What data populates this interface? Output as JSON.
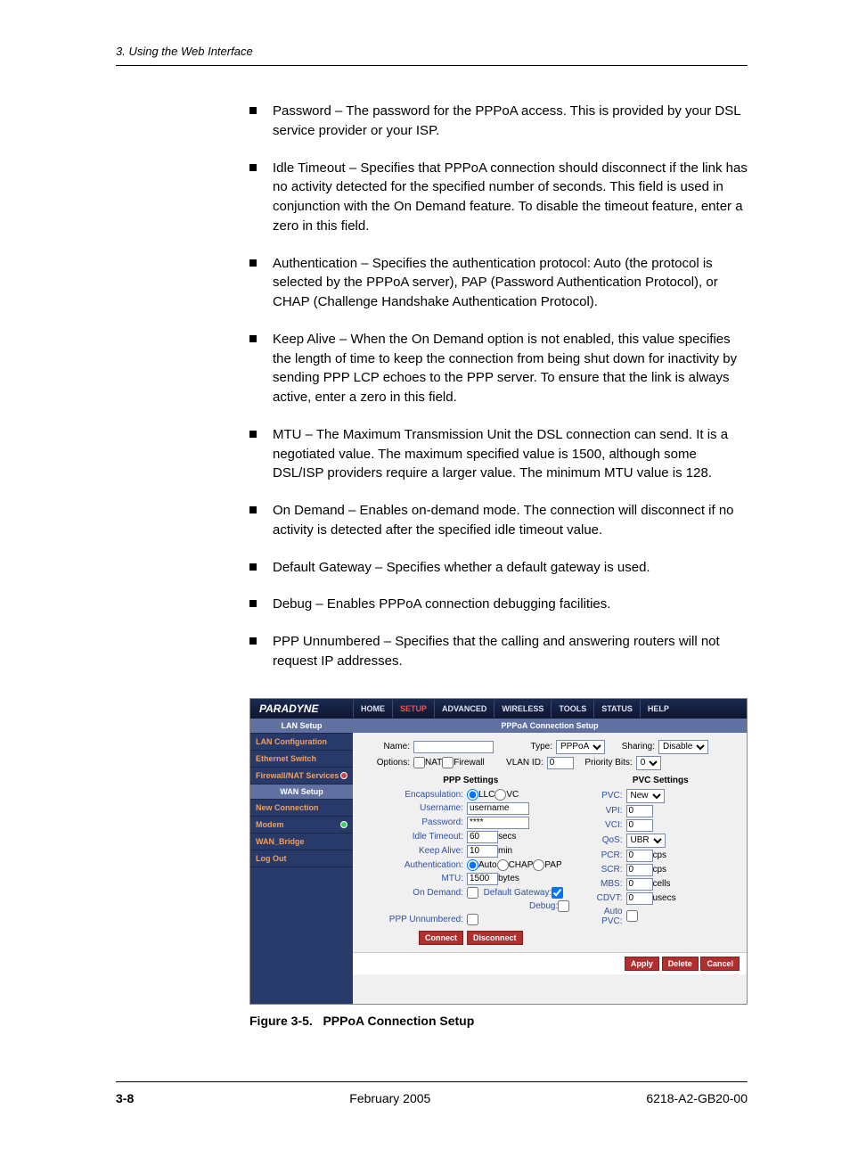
{
  "header": {
    "chapter": "3. Using the Web Interface"
  },
  "bullets": [
    "Password – The password for the PPPoA access. This is provided by your DSL service provider or your ISP.",
    "Idle Timeout – Specifies that PPPoA connection should disconnect if the link has no activity detected for the specified number of seconds. This field is used in conjunction with the On Demand feature. To disable the timeout feature, enter a zero in this field.",
    "Authentication – Specifies the authentication protocol: Auto (the protocol is selected by the PPPoA server), PAP (Password Authentication Protocol), or CHAP (Challenge Handshake Authentication Protocol).",
    "Keep Alive – When the On Demand option is not enabled, this value specifies the length of time to keep the connection from being shut down for inactivity by sending PPP LCP echoes to the PPP server. To ensure that the link is always active, enter a zero in this field.",
    "MTU – The Maximum Transmission Unit the DSL connection can send. It is a negotiated value. The maximum specified value is 1500, although some DSL/ISP providers require a larger value. The minimum MTU value is 128.",
    "On Demand – Enables on-demand mode. The connection will disconnect if no activity is detected after the specified idle timeout value.",
    "Default Gateway – Specifies whether a default gateway is used.",
    "Debug – Enables PPPoA connection debugging facilities.",
    "PPP Unnumbered – Specifies that the calling and answering routers will not request IP addresses."
  ],
  "screenshot": {
    "brand": "PARADYNE",
    "nav": [
      "HOME",
      "SETUP",
      "ADVANCED",
      "WIRELESS",
      "TOOLS",
      "STATUS",
      "HELP"
    ],
    "nav_active": "SETUP",
    "sidebar": {
      "lan_hdr": "LAN Setup",
      "lan_items": [
        "LAN Configuration",
        "Ethernet Switch",
        "Firewall/NAT Services"
      ],
      "wan_hdr": "WAN Setup",
      "wan_items": [
        "New Connection",
        "Modem",
        "WAN_Bridge"
      ],
      "logout": "Log Out"
    },
    "title": "PPPoA Connection Setup",
    "row1": {
      "name_lbl": "Name:",
      "name_val": "",
      "type_lbl": "Type:",
      "type_val": "PPPoA",
      "sharing_lbl": "Sharing:",
      "sharing_val": "Disable"
    },
    "row2": {
      "options_lbl": "Options:",
      "nat": "NAT",
      "firewall": "Firewall",
      "vlan_lbl": "VLAN ID:",
      "vlan_val": "0",
      "prio_lbl": "Priority Bits:",
      "prio_val": "0"
    },
    "ppp": {
      "hdr": "PPP Settings",
      "encap_lbl": "Encapsulation:",
      "llc": "LLC",
      "vc": "VC",
      "user_lbl": "Username:",
      "user_val": "username",
      "pass_lbl": "Password:",
      "pass_val": "****",
      "idle_lbl": "Idle Timeout:",
      "idle_val": "60",
      "idle_unit": "secs",
      "keep_lbl": "Keep Alive:",
      "keep_val": "10",
      "keep_unit": "min",
      "auth_lbl": "Authentication:",
      "auto": "Auto",
      "chap": "CHAP",
      "pap": "PAP",
      "mtu_lbl": "MTU:",
      "mtu_val": "1500",
      "mtu_unit": "bytes",
      "ond_lbl": "On Demand:",
      "dg_lbl": "Default Gateway:",
      "debug_lbl": "Debug:",
      "pppu_lbl": "PPP Unnumbered:",
      "connect": "Connect",
      "disconnect": "Disconnect"
    },
    "pvc": {
      "hdr": "PVC Settings",
      "pvc_lbl": "PVC:",
      "pvc_val": "New",
      "vpi_lbl": "VPI:",
      "vpi_val": "0",
      "vci_lbl": "VCI:",
      "vci_val": "0",
      "qos_lbl": "QoS:",
      "qos_val": "UBR",
      "pcr_lbl": "PCR:",
      "pcr_val": "0",
      "pcr_unit": "cps",
      "scr_lbl": "SCR:",
      "scr_val": "0",
      "scr_unit": "cps",
      "mbs_lbl": "MBS:",
      "mbs_val": "0",
      "mbs_unit": "cells",
      "cdvt_lbl": "CDVT:",
      "cdvt_val": "0",
      "cdvt_unit": "usecs",
      "auto_lbl": "Auto PVC:"
    },
    "footer_btns": {
      "apply": "Apply",
      "delete": "Delete",
      "cancel": "Cancel"
    }
  },
  "caption": {
    "fig": "Figure 3-5.",
    "title": "PPPoA Connection Setup"
  },
  "footer": {
    "page": "3-8",
    "date": "February 2005",
    "doc": "6218-A2-GB20-00"
  }
}
